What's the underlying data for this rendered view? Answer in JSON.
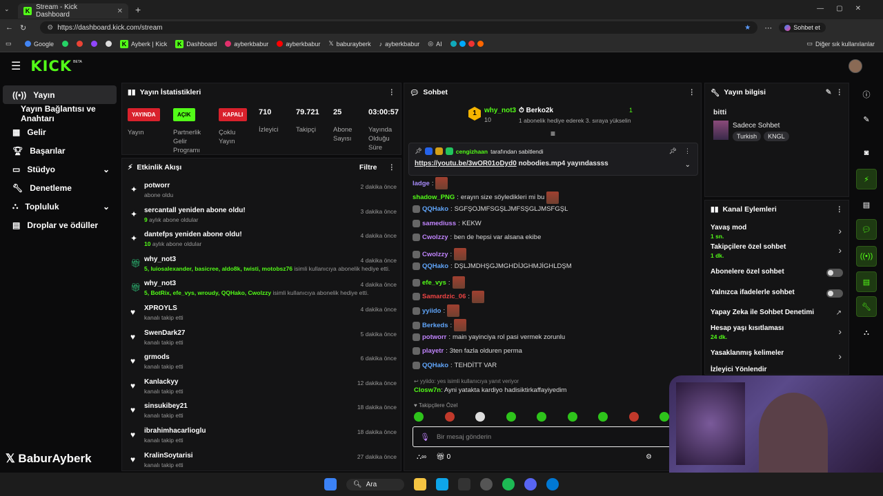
{
  "browser": {
    "tab_title": "Stream - Kick Dashboard",
    "url": "https://dashboard.kick.com/stream",
    "copilot_label": "Sohbet et",
    "bookmarks": [
      "Google",
      "",
      "",
      "",
      "",
      "Ayberk | Kick",
      "Dashboard",
      "ayberkbabur",
      "ayberkbabur",
      "baburayberk",
      "ayberkbabur",
      "AI"
    ],
    "other_bookmarks": "Diğer sık kullanılanlar"
  },
  "header": {
    "logo": "KICK",
    "beta": "BETA"
  },
  "sidebar": {
    "items": [
      {
        "label": "Yayın",
        "icon": "broadcast-icon"
      },
      {
        "label": "Yayın Bağlantısı ve Anahtarı",
        "icon": ""
      },
      {
        "label": "Gelir",
        "icon": "revenue-icon"
      },
      {
        "label": "Başarılar",
        "icon": "trophy-icon"
      },
      {
        "label": "Stüdyo",
        "icon": "studio-icon"
      },
      {
        "label": "Denetleme",
        "icon": "wrench-icon"
      },
      {
        "label": "Topluluk",
        "icon": "community-icon"
      },
      {
        "label": "Droplar ve ödüller",
        "icon": "drops-icon"
      }
    ],
    "watermark": "BaburAyberk"
  },
  "stats": {
    "title": "Yayın İstatistikleri",
    "stream_badge": "YAYINDA",
    "stream_label": "Yayın",
    "partner_badge": "AÇIK",
    "partner_label": "Partnerlik Gelir Programı",
    "multistream_badge": "KAPALI",
    "multistream_label": "Çoklu Yayın",
    "viewers": "710",
    "viewers_label": "İzleyici",
    "followers": "79.721",
    "followers_label": "Takipçi",
    "subs": "25",
    "subs_label": "Abone Sayısı",
    "uptime": "03:00:57",
    "uptime_label": "Yayında Olduğu Süre"
  },
  "activity": {
    "title": "Etkinlik Akışı",
    "filter": "Filtre",
    "items": [
      {
        "name": "potworr",
        "sub": "abone oldu",
        "time": "2 dakika önce",
        "icon": "sparkle"
      },
      {
        "name": "sercantall yeniden abone oldu!",
        "sub_prefix": "9",
        "sub": "aylık abone oldular",
        "time": "3 dakika önce",
        "icon": "sparkle"
      },
      {
        "name": "dantefps yeniden abone oldu!",
        "sub_prefix": "10",
        "sub": "aylık abone oldular",
        "time": "4 dakika önce",
        "icon": "sparkle"
      },
      {
        "name": "why_not3",
        "sub_prefix": "5, luiosalexander, basicree, aldo8k, twisti, motobsz76",
        "sub": "isimli kullanıcıya abonelik hediye etti.",
        "time": "4 dakika önce",
        "icon": "gift"
      },
      {
        "name": "why_not3",
        "sub_prefix": "5, BotRix, efe_vys, wroudy, QQHako, Cwolzzy",
        "sub": "isimli kullanıcıya abonelik hediye etti.",
        "time": "4 dakika önce",
        "icon": "gift"
      },
      {
        "name": "XPROYLS",
        "sub": "kanalı takip etti",
        "time": "4 dakika önce",
        "icon": "heart"
      },
      {
        "name": "SwenDark27",
        "sub": "kanalı takip etti",
        "time": "5 dakika önce",
        "icon": "heart"
      },
      {
        "name": "grmods",
        "sub": "kanalı takip etti",
        "time": "6 dakika önce",
        "icon": "heart"
      },
      {
        "name": "Kanlackyy",
        "sub": "kanalı takip etti",
        "time": "12 dakika önce",
        "icon": "heart"
      },
      {
        "name": "sinsukibey21",
        "sub": "kanalı takip etti",
        "time": "18 dakika önce",
        "icon": "heart"
      },
      {
        "name": "ibrahimhacarlioglu",
        "sub": "kanalı takip etti",
        "time": "18 dakika önce",
        "icon": "heart"
      },
      {
        "name": "KralinSoytarisi",
        "sub": "kanalı takip etti",
        "time": "27 dakika önce",
        "icon": "heart"
      }
    ]
  },
  "chat": {
    "title": "Sohbet",
    "gifter_name": "why_not3",
    "gifter_count": "10",
    "gift_target": "Berko2k",
    "gift_text": "1 abonelik hediye ederek 3. sıraya yükselin",
    "gift_rank": "1",
    "pinned_by": "cengizhaan",
    "pinned_by_suffix": "tarafından sabitlendi",
    "pinned_link": "https://youtu.be/3wOR01oDyd0",
    "pinned_text": "nobodies.mp4 yayındassss",
    "messages": [
      {
        "user": "ladge",
        "color": "#a78bfa",
        "text": "",
        "emote": true
      },
      {
        "user": "shadow_PNG",
        "color": "#53fc18",
        "text": "erayın size söyledikleri mi bu",
        "emote": true
      },
      {
        "user": "QQHako",
        "color": "#60a5fa",
        "text": "SGFŞOJMFSGŞLJMFSŞGLJMSFGŞL",
        "emote": false
      },
      {
        "user": "samediuss",
        "color": "#c084fc",
        "text": "KEKW",
        "emote": false
      },
      {
        "user": "Cwolzzy",
        "color": "#c084fc",
        "text": "ben de hepsi var alsana ekibe",
        "emote": false
      },
      {
        "user": "Cwolzzy",
        "color": "#c084fc",
        "text": "",
        "emote": true
      },
      {
        "user": "QQHako",
        "color": "#60a5fa",
        "text": "DŞLJMDHŞGJMGHDİJGHMJİGHLDŞM",
        "emote": false
      },
      {
        "user": "efe_vys",
        "color": "#53fc18",
        "text": "",
        "emote": true
      },
      {
        "user": "Samardzic_06",
        "color": "#ef4444",
        "text": "",
        "emote": true
      },
      {
        "user": "yyiido",
        "color": "#60a5fa",
        "text": "",
        "emote": true
      },
      {
        "user": "Berkeds",
        "color": "#60a5fa",
        "text": "",
        "emote": true
      },
      {
        "user": "potworr",
        "color": "#c084fc",
        "text": "main yayinciya rol pasi vermek zorunlu",
        "emote": false
      },
      {
        "user": "playetr",
        "color": "#c084fc",
        "text": "3ten fazla olduren perma",
        "emote": false
      },
      {
        "user": "QQHako",
        "color": "#60a5fa",
        "text": "TEHDİTT VAR",
        "emote": false
      }
    ],
    "reply_hint": "yyiido: yes isimli kullanıcıya yanıt veriyor",
    "reply_user": "Closw7n",
    "reply_text": "Ayni yatakta kardiyo hadisiktirkaffayiyedim",
    "followers_only": "Takipçilere Özel",
    "input_placeholder": "Bir mesaj gönderin",
    "points": "0"
  },
  "stream_info": {
    "title": "Yayın bilgisi",
    "stream_title": "bitti",
    "category": "Sadece Sohbet",
    "tags": [
      "Turkish",
      "KNGL"
    ]
  },
  "channel_actions": {
    "title": "Kanal Eylemleri",
    "items": [
      {
        "label": "Yavaş mod",
        "sub": "1 sn.",
        "control": "arrow"
      },
      {
        "label": "Takipçilere özel sohbet",
        "sub": "1 dk.",
        "control": "arrow"
      },
      {
        "label": "Abonelere özel sohbet",
        "sub": "",
        "control": "toggle"
      },
      {
        "label": "Yalnızca ifadelerle sohbet",
        "sub": "",
        "control": "toggle"
      },
      {
        "label": "Yapay Zeka ile Sohbet Denetimi",
        "sub": "",
        "control": "link"
      },
      {
        "label": "Hesap yaşı kısıtlaması",
        "sub": "24 dk.",
        "control": "arrow"
      },
      {
        "label": "Yasaklanmış kelimeler",
        "sub": "",
        "control": "arrow"
      },
      {
        "label": "İzleyici Yönlendir",
        "sub": "",
        "control": "none"
      }
    ]
  },
  "taskbar": {
    "search": "Ara"
  }
}
